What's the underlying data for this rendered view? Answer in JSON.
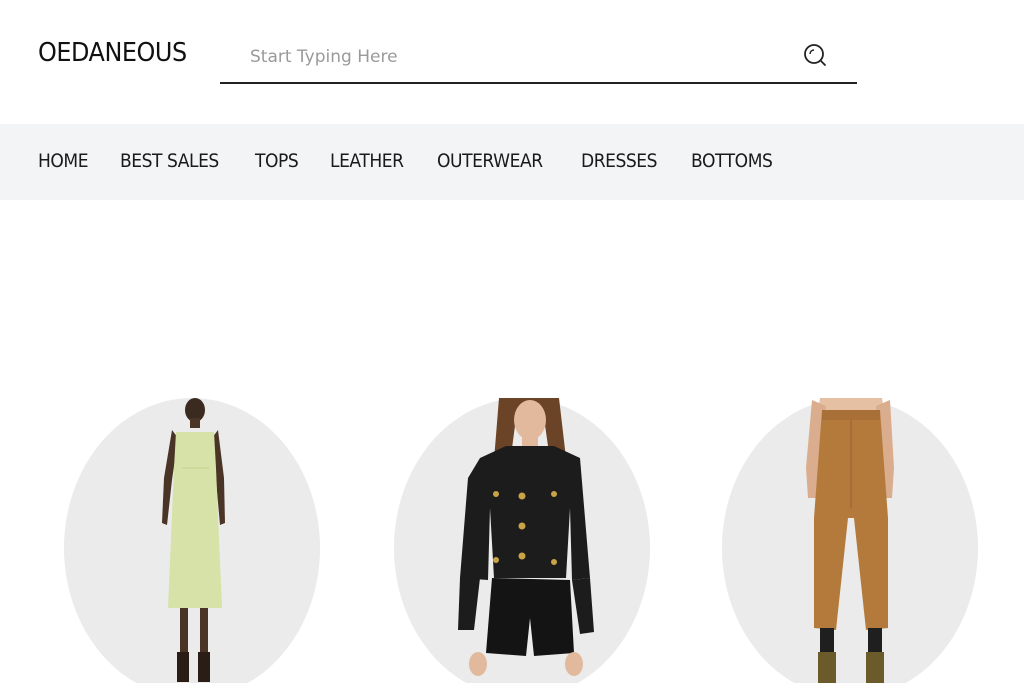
{
  "brand": {
    "name": "OEDANEOUS"
  },
  "search": {
    "placeholder": "Start Typing Here",
    "value": "",
    "icon": "search-icon"
  },
  "nav": {
    "items": [
      {
        "label": "HOME"
      },
      {
        "label": "BEST SALES"
      },
      {
        "label": "TOPS"
      },
      {
        "label": "LEATHER"
      },
      {
        "label": "OUTERWEAR"
      },
      {
        "label": "DRESSES"
      },
      {
        "label": "BOTTOMS"
      }
    ]
  },
  "products": [
    {
      "image": "slip-dress-image",
      "color": "#d6e2a8"
    },
    {
      "image": "leather-jacket-image",
      "color": "#1c1c1c"
    },
    {
      "image": "camel-trousers-image",
      "color": "#b47a3c"
    }
  ],
  "colors": {
    "nav_bg": "#f3f4f6",
    "oval_bg": "#ebebeb",
    "text": "#111111"
  }
}
